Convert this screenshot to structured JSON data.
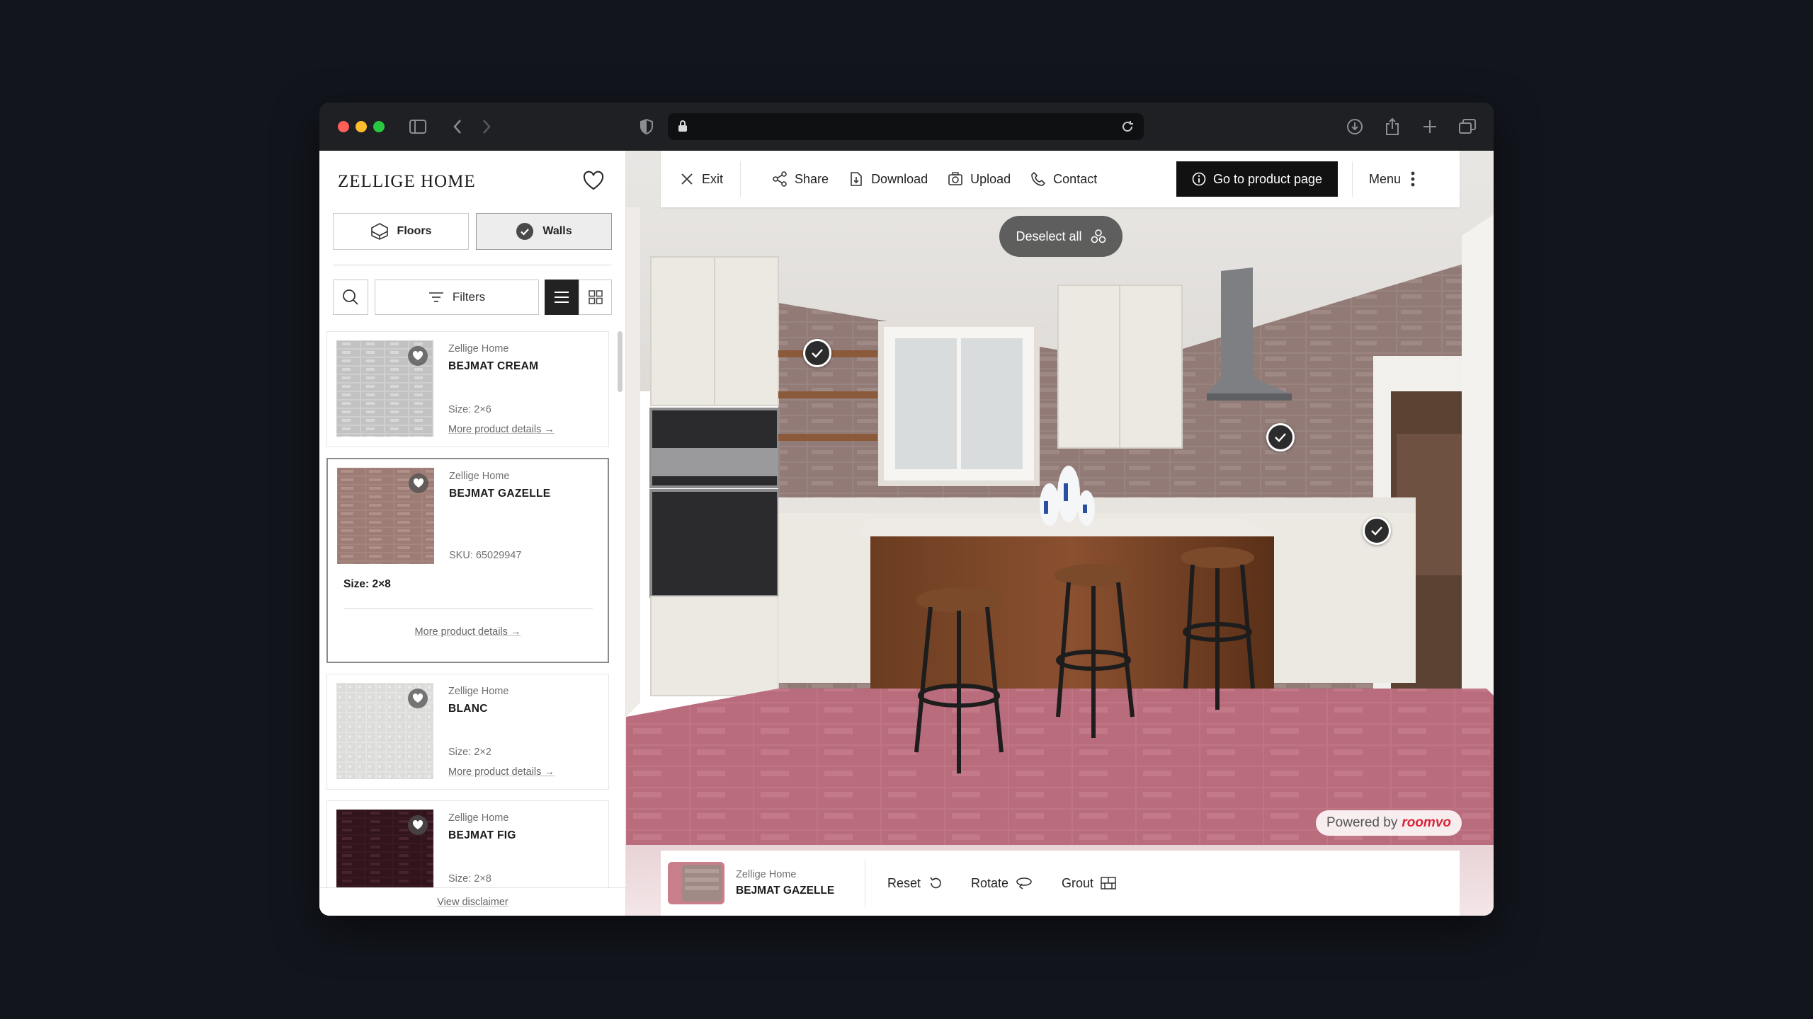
{
  "sidebar": {
    "brand": "ZELLIGE HOME",
    "tabs": {
      "floors": "Floors",
      "walls": "Walls"
    },
    "filters_label": "Filters",
    "products": [
      {
        "brand": "Zellige Home",
        "name": "BEJMAT CREAM",
        "size": "Size: 2×6",
        "more": "More product details →"
      },
      {
        "brand": "Zellige Home",
        "name": "BEJMAT GAZELLE",
        "sku": "SKU: 65029947",
        "size": "Size: 2×8",
        "more": "More product details →"
      },
      {
        "brand": "Zellige Home",
        "name": "BLANC",
        "size": "Size: 2×2",
        "more": "More product details →"
      },
      {
        "brand": "Zellige Home",
        "name": "BEJMAT FIG",
        "size": "Size: 2×8"
      }
    ],
    "disclaimer": "View disclaimer"
  },
  "toolbar": {
    "exit": "Exit",
    "share": "Share",
    "download": "Download",
    "upload": "Upload",
    "contact": "Contact",
    "goto_product": "Go to product page",
    "menu": "Menu"
  },
  "viewer": {
    "deselect_all": "Deselect all",
    "powered_by": "Powered by",
    "powered_brand": "roomvo"
  },
  "bottombar": {
    "selected_brand": "Zellige Home",
    "selected_name": "BEJMAT GAZELLE",
    "reset": "Reset",
    "rotate": "Rotate",
    "grout": "Grout"
  },
  "colors": {
    "accent_dark": "#111111",
    "floor_pink": "#c27886",
    "wall_tile": "#9b8582",
    "traffic_red": "#fe5f57",
    "traffic_yellow": "#febc2e",
    "traffic_green": "#28c840"
  }
}
